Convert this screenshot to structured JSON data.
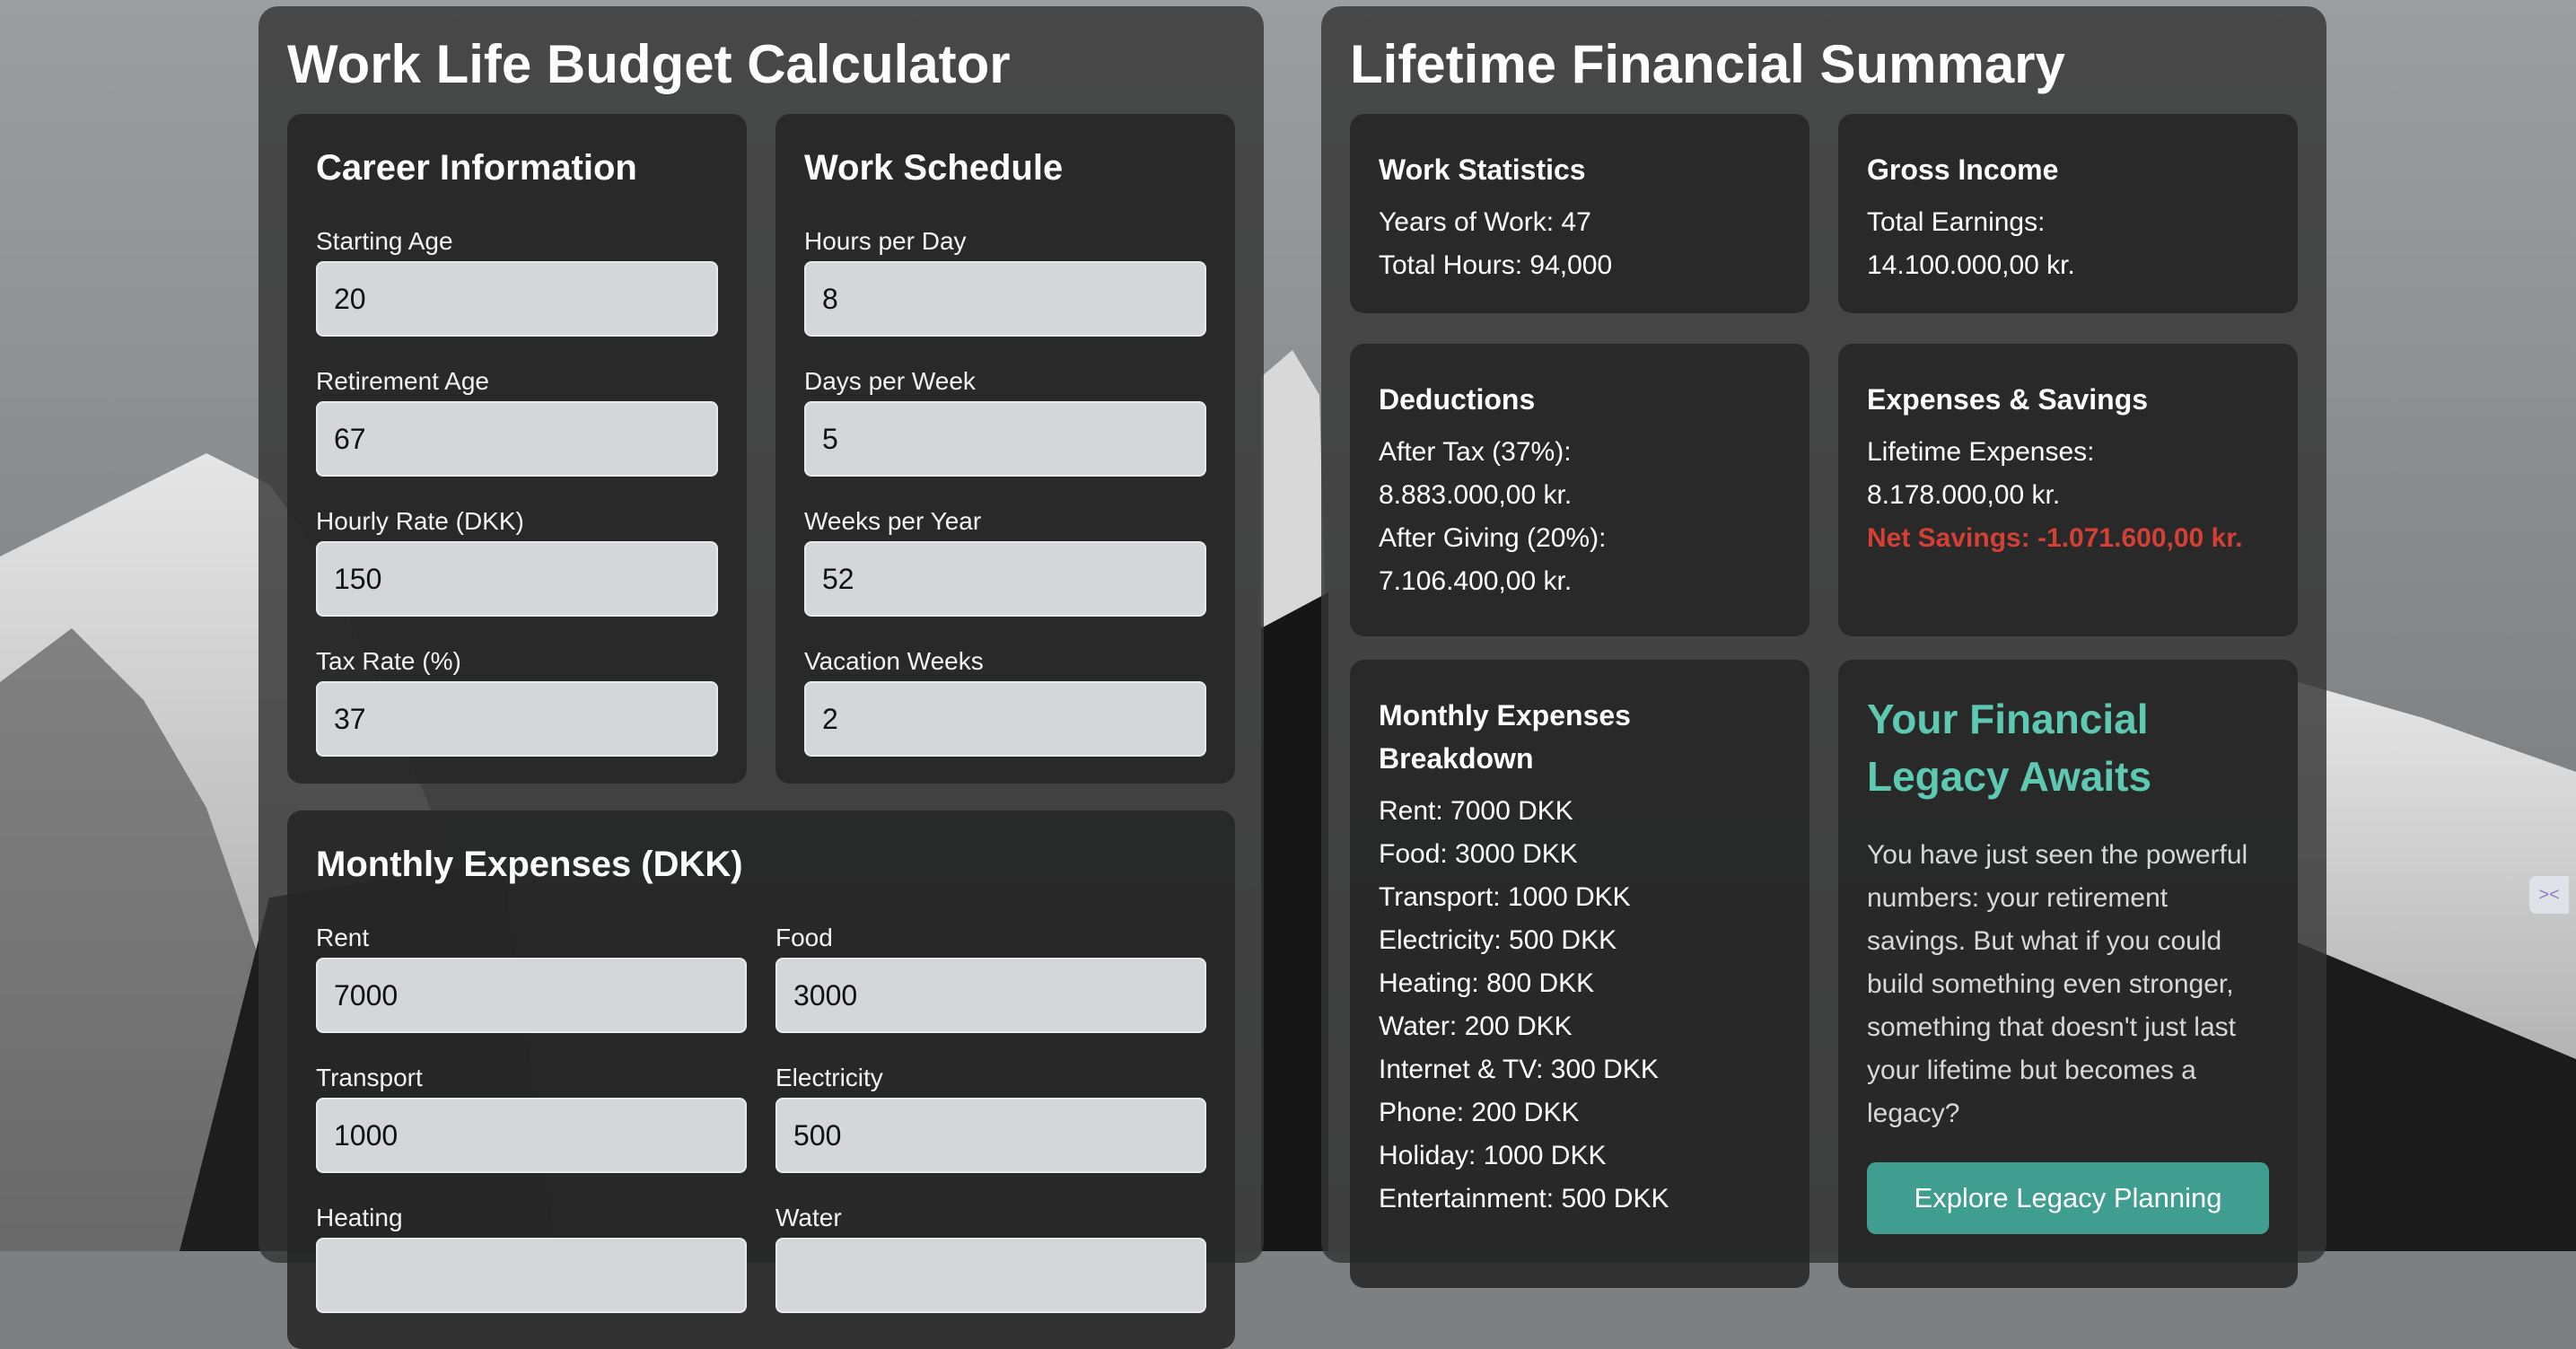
{
  "calculator": {
    "title": "Work Life Budget Calculator",
    "career": {
      "title": "Career Information",
      "fields": [
        {
          "label": "Starting Age",
          "value": "20"
        },
        {
          "label": "Retirement Age",
          "value": "67"
        },
        {
          "label": "Hourly Rate (DKK)",
          "value": "150"
        },
        {
          "label": "Tax Rate (%)",
          "value": "37"
        }
      ]
    },
    "schedule": {
      "title": "Work Schedule",
      "fields": [
        {
          "label": "Hours per Day",
          "value": "8"
        },
        {
          "label": "Days per Week",
          "value": "5"
        },
        {
          "label": "Weeks per Year",
          "value": "52"
        },
        {
          "label": "Vacation Weeks",
          "value": "2"
        }
      ]
    },
    "expenses": {
      "title": "Monthly Expenses (DKK)",
      "fields": [
        {
          "label": "Rent",
          "value": "7000"
        },
        {
          "label": "Food",
          "value": "3000"
        },
        {
          "label": "Transport",
          "value": "1000"
        },
        {
          "label": "Electricity",
          "value": "500"
        },
        {
          "label": "Heating",
          "value": ""
        },
        {
          "label": "Water",
          "value": ""
        }
      ]
    }
  },
  "summary": {
    "title": "Lifetime Financial Summary",
    "work_stats": {
      "title": "Work Statistics",
      "lines": [
        "Years of Work: 47",
        "Total Hours: 94,000"
      ]
    },
    "gross_income": {
      "title": "Gross Income",
      "lines": [
        "Total Earnings:",
        "14.100.000,00 kr."
      ]
    },
    "deductions": {
      "title": "Deductions",
      "lines": [
        "After Tax (37%):",
        "8.883.000,00 kr.",
        "After Giving (20%):",
        "7.106.400,00 kr."
      ]
    },
    "expenses_savings": {
      "title": "Expenses & Savings",
      "lines": [
        "Lifetime Expenses:",
        "8.178.000,00 kr."
      ],
      "net_savings": "Net Savings: -1.071.600,00 kr."
    },
    "breakdown": {
      "title_line1": "Monthly Expenses",
      "title_line2": "Breakdown",
      "items": [
        "Rent: 7000 DKK",
        "Food: 3000 DKK",
        "Transport: 1000 DKK",
        "Electricity: 500 DKK",
        "Heating: 800 DKK",
        "Water: 200 DKK",
        "Internet & TV: 300 DKK",
        "Phone: 200 DKK",
        "Holiday: 1000 DKK",
        "Entertainment: 500 DKK"
      ]
    },
    "legacy": {
      "title": "Your Financial Legacy Awaits",
      "text": "You have just seen the powerful numbers: your retirement savings. But what if you could build something even stronger, something that doesn't just last your lifetime but becomes a legacy?",
      "button": "Explore Legacy Planning"
    }
  },
  "colors": {
    "accent": "#5ec9b3",
    "button": "#3f9e90",
    "negative": "#d43f36"
  }
}
